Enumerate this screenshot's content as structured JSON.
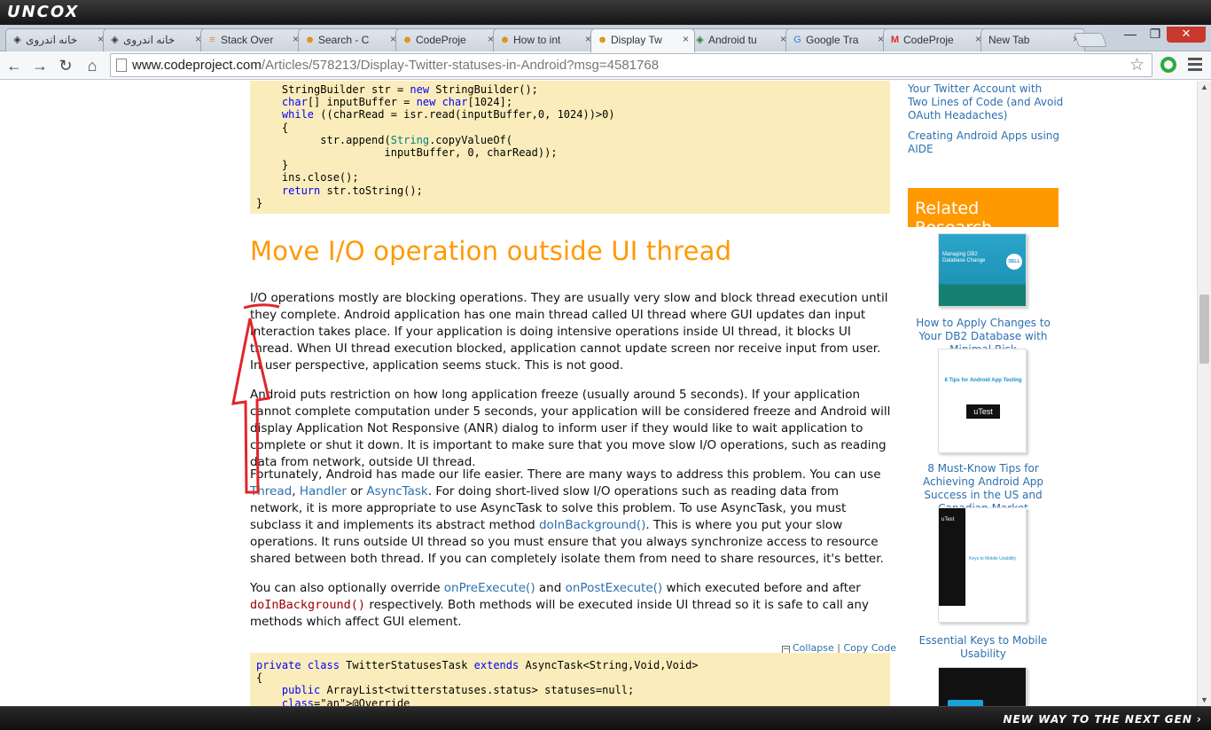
{
  "brand": {
    "logo": "UNCOX",
    "slogan": "NEW WAY TO THE NEXT GEN ›"
  },
  "tabs": [
    {
      "label": "خانه اندروی",
      "icon": "diamond-icon",
      "active": false
    },
    {
      "label": "خانه اندروی",
      "icon": "diamond-icon",
      "active": false
    },
    {
      "label": "Stack Over",
      "icon": "stack-icon",
      "active": false
    },
    {
      "label": "Search - C",
      "icon": "codeproject-icon",
      "active": false
    },
    {
      "label": "CodeProje",
      "icon": "codeproject-icon",
      "active": false
    },
    {
      "label": "How to int",
      "icon": "codeproject-icon",
      "active": false
    },
    {
      "label": "Display Tw",
      "icon": "codeproject-icon",
      "active": true
    },
    {
      "label": "Android tu",
      "icon": "diamond-icon",
      "active": false
    },
    {
      "label": "Google Tra",
      "icon": "translate-icon",
      "active": false
    },
    {
      "label": "CodeProje",
      "icon": "gmail-icon",
      "active": false
    },
    {
      "label": "New Tab",
      "icon": "",
      "active": false
    }
  ],
  "window": {
    "minimize": "—",
    "restore": "❐",
    "close": "✕"
  },
  "toolbar": {
    "back": "←",
    "forward": "→",
    "reload": "↻",
    "home": "⌂",
    "url_host": "www.codeproject.com",
    "url_rest": "/Articles/578213/Display-Twitter-statuses-in-Android?msg=4581768",
    "star": "☆"
  },
  "article": {
    "code1": [
      "    StringBuilder str = new StringBuilder();",
      "    char[] inputBuffer = new char[1024];",
      "    while ((charRead = isr.read(inputBuffer,0, 1024))>0)",
      "    {",
      "          str.append(String.copyValueOf(",
      "                    inputBuffer, 0, charRead));",
      "    }",
      "    ins.close();",
      "    return str.toString();",
      "}"
    ],
    "heading": "Move I/O operation outside UI thread",
    "p1": "I/O operations mostly are blocking operations. They are usually very slow and block thread execution until they complete. Android application has one main thread called UI thread where GUI updates dan input interaction takes place. If your application is doing intensive operations inside UI thread, it blocks UI thread. When UI thread execution blocked, application cannot update screen nor receive input from user. In user perspective, application seems stuck. This is not good.",
    "p2": "Android puts restriction on how long application freeze (usually around 5 seconds). If your application cannot complete computation under 5 seconds, your application will be considered freeze and Android will display Application Not Responsive (ANR) dialog to inform user if they would like to wait application to complete or shut it down. It is important to make sure that you move slow I/O operations, such as reading data from network, outside UI thread.",
    "p3_a": "Fortunately, Android has made our life easier. There are many ways to address this problem. You can use ",
    "p3_thread": "Thread",
    "p3_comma": ", ",
    "p3_handler": "Handler",
    "p3_or": " or ",
    "p3_asynctask": "AsyncTask",
    "p3_b": ". For doing short-lived slow I/O operations such as reading data from network, it is more appropriate to use AsyncTask to solve this problem. To use AsyncTask, you must subclass it and implements its abstract method ",
    "p3_doin": "doInBackground()",
    "p3_c": ". This is where you put your slow operations. It runs outside UI thread so you must ensure that you always synchronize access to resource shared between both thread. If you can completely isolate them from need to share resources, it's better.",
    "p4_a": "You can also optionally override ",
    "p4_pre": "onPreExecute()",
    "p4_and": " and ",
    "p4_post": "onPostExecute()",
    "p4_b": " which executed before and after ",
    "p4_doin": "doInBackground()",
    "p4_c": " respectively. Both methods will be executed inside UI thread so it is safe to call any methods which affect GUI element.",
    "collapse": "Collapse",
    "separator": "|",
    "copy_code": "Copy Code",
    "code2": [
      "private class TwitterStatusesTask extends AsyncTask<String,Void,Void>",
      "{",
      "    public ArrayList<twitterstatuses.status> statuses=null;",
      "    @Override"
    ]
  },
  "sidebar": {
    "link1": "Your Twitter Account with Two Lines of Code (and Avoid OAuth Headaches)",
    "link2": "Creating Android Apps using AIDE",
    "research_title": "Related Research",
    "items": [
      {
        "caption": "How to Apply Changes to Your DB2 Database with Minimal Risk",
        "thumb_title": "Managing DB2 Database Change",
        "thumb_badge": "DELL"
      },
      {
        "caption": "8 Must-Know Tips for Achieving Android App Success in the US and Canadian Market",
        "thumb_title": "8 Tips for Android App Testing",
        "thumb_badge": "uTest"
      },
      {
        "caption": "Essential Keys to Mobile Usability",
        "thumb_title": "Keys to Mobile Usability",
        "thumb_badge": "uTest"
      }
    ]
  },
  "scrollbar": {
    "position": 0.33
  },
  "colors": {
    "heading": "#ff9900",
    "link": "#2e6faf",
    "code_bg": "#fbedbb",
    "annotation": "#e0262a"
  }
}
